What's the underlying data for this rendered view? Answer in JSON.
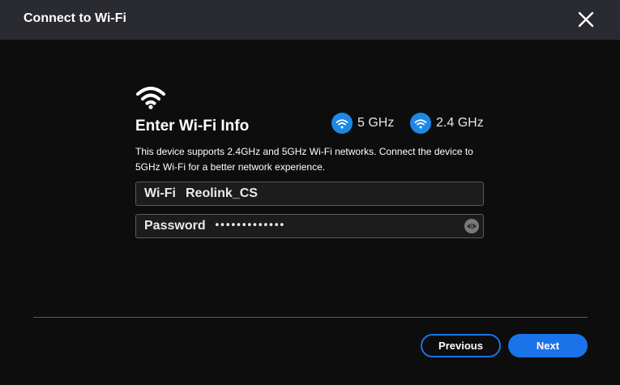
{
  "dialog": {
    "title": "Connect to Wi-Fi",
    "close_icon": "close-icon"
  },
  "wifi_info": {
    "icon": "wifi-icon",
    "heading": "Enter Wi-Fi Info",
    "bands": [
      {
        "icon": "wifi-5ghz-icon",
        "label": "5 GHz"
      },
      {
        "icon": "wifi-2-4ghz-icon",
        "label": "2.4 GHz"
      }
    ],
    "description": "This device supports 2.4GHz and 5GHz Wi-Fi networks. Connect the device to 5GHz Wi-Fi for a better network experience."
  },
  "form": {
    "ssid_label": "Wi-Fi",
    "ssid_value": "Reolink_CS",
    "password_label": "Password",
    "password_value": "•••••••••••••",
    "show_password_icon": "eye-icon"
  },
  "footer": {
    "previous_label": "Previous",
    "next_label": "Next"
  },
  "colors": {
    "accent": "#1a73e8",
    "title_bar": "#2a2b30",
    "background": "#0d0d0d"
  }
}
